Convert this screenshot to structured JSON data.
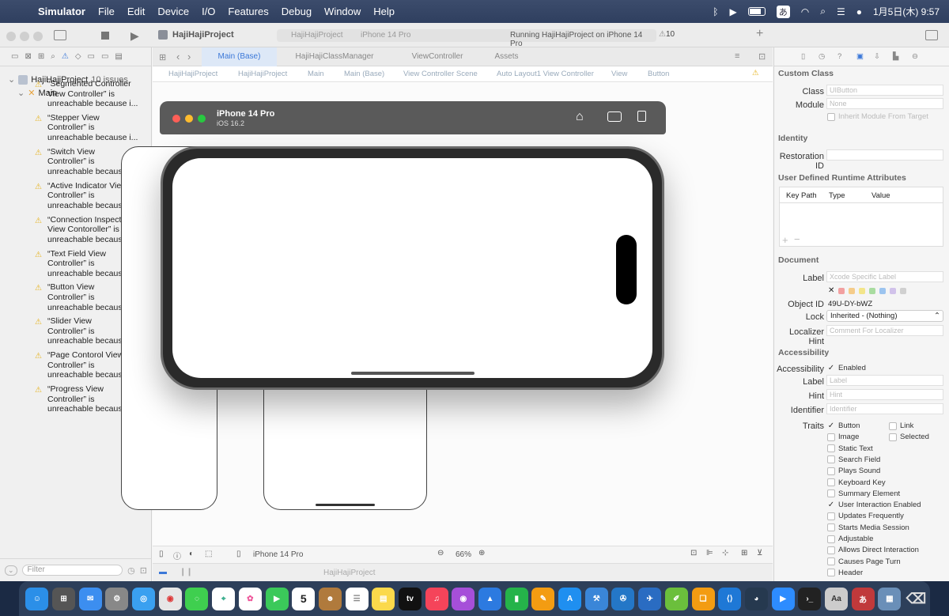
{
  "menubar": {
    "app": "Simulator",
    "items": [
      "File",
      "Edit",
      "Device",
      "I/O",
      "Features",
      "Debug",
      "Window",
      "Help"
    ],
    "clock": "1月5日(木) 9:57",
    "input_method": "あ"
  },
  "toolbar": {
    "project": "HajiHajiProject",
    "scheme": "HajiHajiProject",
    "destination": "iPhone 14 Pro",
    "status": "Running HajiHajiProject on iPhone 14 Pro",
    "warnings": "10"
  },
  "navigator": {
    "root": "HajiHajiProject",
    "root_issues": "10 issues",
    "group": "Main",
    "issues": [
      [
        "“Segmented Controller",
        "View Controller” is",
        "unreachable because i..."
      ],
      [
        "“Stepper View",
        "Controller” is",
        "unreachable because i..."
      ],
      [
        "“Switch View",
        "Controller” is",
        "unreachable because i..."
      ],
      [
        "“Active Indicator View",
        "Controller” is",
        "unreachable because i..."
      ],
      [
        "“Connection Inspector",
        "View Contoroller” is",
        "unreachable because i..."
      ],
      [
        "“Text Field View",
        "Controller” is",
        "unreachable because i..."
      ],
      [
        "“Button View",
        "Controller” is",
        "unreachable because i..."
      ],
      [
        "“Slider View",
        "Controller” is",
        "unreachable because i..."
      ],
      [
        "“Page Contorol View",
        "Controller” is",
        "unreachable because i..."
      ],
      [
        "“Progress View",
        "Controller” is",
        "unreachable because i..."
      ]
    ],
    "filter_placeholder": "Filter"
  },
  "tabs": [
    "Main (Base)",
    "HajiHajiClassManager",
    "ViewController",
    "Assets"
  ],
  "jumpbar": [
    "HajiHajiProject",
    "HajiHajiProject",
    "Main",
    "Main (Base)",
    "View Controller Scene",
    "Auto Layout1 View Controller",
    "View",
    "Button"
  ],
  "bottombar": {
    "device": "iPhone 14 Pro",
    "zoom": "66%"
  },
  "debugbar": {
    "target": "HajiHajiProject"
  },
  "simulator": {
    "device": "iPhone 14 Pro",
    "os": "iOS 16.2"
  },
  "inspector": {
    "custom_class": {
      "title": "Custom Class",
      "class_label": "Class",
      "class_value": "UIButton",
      "module_label": "Module",
      "module_value": "None",
      "inherit": "Inherit Module From Target"
    },
    "identity": {
      "title": "Identity",
      "restoration_label": "Restoration ID"
    },
    "runtime": {
      "title": "User Defined Runtime Attributes",
      "cols": [
        "Key Path",
        "Type",
        "Value"
      ]
    },
    "document": {
      "title": "Document",
      "label_label": "Label",
      "label_placeholder": "Xcode Specific Label",
      "object_id_label": "Object ID",
      "object_id": "49U-DY-bWZ",
      "lock_label": "Lock",
      "lock_value": "Inherited - (Nothing)",
      "hint_label": "Localizer Hint",
      "hint_placeholder": "Comment For Localizer"
    },
    "accessibility": {
      "title": "Accessibility",
      "acc_label": "Accessibility",
      "enabled": "Enabled",
      "label_label": "Label",
      "label_placeholder": "Label",
      "hint_label": "Hint",
      "hint_placeholder": "Hint",
      "identifier_label": "Identifier",
      "identifier_placeholder": "Identifier",
      "traits_label": "Traits",
      "traits": [
        [
          "Button",
          true
        ],
        [
          "Image",
          false
        ],
        [
          "Static Text",
          false
        ],
        [
          "Search Field",
          false
        ],
        [
          "Plays Sound",
          false
        ],
        [
          "Keyboard Key",
          false
        ],
        [
          "Summary Element",
          false
        ],
        [
          "User Interaction Enabled",
          true
        ],
        [
          "Updates Frequently",
          false
        ],
        [
          "Starts Media Session",
          false
        ],
        [
          "Adjustable",
          false
        ],
        [
          "Allows Direct Interaction",
          false
        ],
        [
          "Causes Page Turn",
          false
        ],
        [
          "Header",
          false
        ]
      ],
      "traits_col2": [
        [
          "Link",
          false
        ],
        [
          "Selected",
          false
        ]
      ]
    }
  },
  "dock": {
    "calendar_day": "5",
    "tv_label": "tv"
  }
}
